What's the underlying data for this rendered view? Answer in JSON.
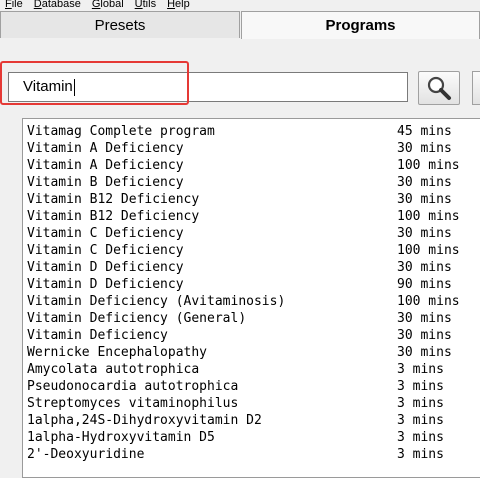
{
  "menu": [
    "File",
    "Database",
    "Global",
    "Utils",
    "Help"
  ],
  "tabs": [
    {
      "label": "Presets",
      "active": false
    },
    {
      "label": "Programs",
      "active": true
    }
  ],
  "search": {
    "value": "Vitamin"
  },
  "programs": [
    {
      "name": "Vitamag Complete program",
      "duration": "45 mins"
    },
    {
      "name": "Vitamin A Deficiency",
      "duration": "30 mins"
    },
    {
      "name": "Vitamin A Deficiency",
      "duration": "100 mins"
    },
    {
      "name": "Vitamin B Deficiency",
      "duration": "30 mins"
    },
    {
      "name": "Vitamin B12 Deficiency",
      "duration": "30 mins"
    },
    {
      "name": "Vitamin B12 Deficiency",
      "duration": "100 mins"
    },
    {
      "name": "Vitamin C Deficiency",
      "duration": "30 mins"
    },
    {
      "name": "Vitamin C Deficiency",
      "duration": "100 mins"
    },
    {
      "name": "Vitamin D Deficiency",
      "duration": "30 mins"
    },
    {
      "name": "Vitamin D Deficiency",
      "duration": "90 mins"
    },
    {
      "name": "Vitamin Deficiency (Avitaminosis)",
      "duration": "100 mins"
    },
    {
      "name": "Vitamin Deficiency (General)",
      "duration": "30 mins"
    },
    {
      "name": "Vitamin Deficiency",
      "duration": "30 mins"
    },
    {
      "name": "Wernicke Encephalopathy",
      "duration": "30 mins"
    },
    {
      "name": "Amycolata autotrophica",
      "duration": "3 mins"
    },
    {
      "name": "Pseudonocardia autotrophica",
      "duration": "3 mins"
    },
    {
      "name": "Streptomyces vitaminophilus",
      "duration": "3 mins"
    },
    {
      "name": "1alpha,24S-Dihydroxyvitamin D2",
      "duration": "3 mins"
    },
    {
      "name": "1alpha-Hydroxyvitamin D5",
      "duration": "3 mins"
    },
    {
      "name": "2'-Deoxyuridine",
      "duration": "3 mins"
    }
  ],
  "colors": {
    "highlight": "#e53935",
    "panel": "#f0f0f0"
  },
  "icons": {
    "search": "magnifier-icon"
  }
}
